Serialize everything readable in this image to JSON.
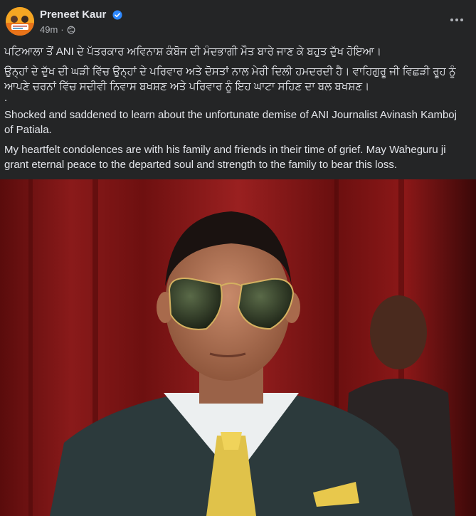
{
  "post": {
    "author": "Preneet Kaur",
    "time": "49m",
    "sep": "·",
    "punjabi_line1": "ਪਟਿਆਲਾ ਤੋਂ ANI ਦੇ ਪੱਤਰਕਾਰ ਅਵਿਨਾਸ਼ ਕੰਬੋਜ ਦੀ ਮੰਦਭਾਗੀ ਮੌਤ ਬਾਰੇ ਜਾਣ ਕੇ ਬਹੁਤ ਦੁੱਖ ਹੋਇਆ।",
    "punjabi_line2": "ਉਨ੍ਹਾਂ ਦੇ ਦੁੱਖ ਦੀ ਘੜੀ ਵਿੱਚ ਉਨ੍ਹਾਂ ਦੇ ਪਰਿਵਾਰ ਅਤੇ ਦੋਸਤਾਂ ਨਾਲ ਮੇਰੀ ਦਿਲੀ ਹਮਦਰਦੀ ਹੈ। ਵਾਹਿਗੁਰੂ ਜੀ ਵਿਛੜੀ ਰੂਹ ਨੂੰ ਆਪਣੇ ਚਰਨਾਂ ਵਿੱਚ ਸਦੀਵੀ ਨਿਵਾਸ ਬਖਸ਼ਣ ਅਤੇ ਪਰਿਵਾਰ ਨੂੰ ਇਹ ਘਾਟਾ ਸਹਿਣ ਦਾ ਬਲ ਬਖਸ਼ਣ।",
    "dot": ".",
    "english_para1": "Shocked and saddened to learn about the unfortunate demise of ANI Journalist Avinash Kamboj of Patiala.",
    "english_para2": "My heartfelt condolences are with his family and friends in their time of grief. May Waheguru ji grant eternal peace to the departed soul and strength to the family to bear this loss."
  },
  "icons": {
    "verified": "verified-badge-icon",
    "privacy": "globe-icon",
    "more": "more-options-icon"
  },
  "colors": {
    "background": "#242526",
    "text": "#e4e6eb",
    "secondary_text": "#b0b3b8",
    "verified": "#2d88ff",
    "photo_backdrop": "#6e1010"
  }
}
